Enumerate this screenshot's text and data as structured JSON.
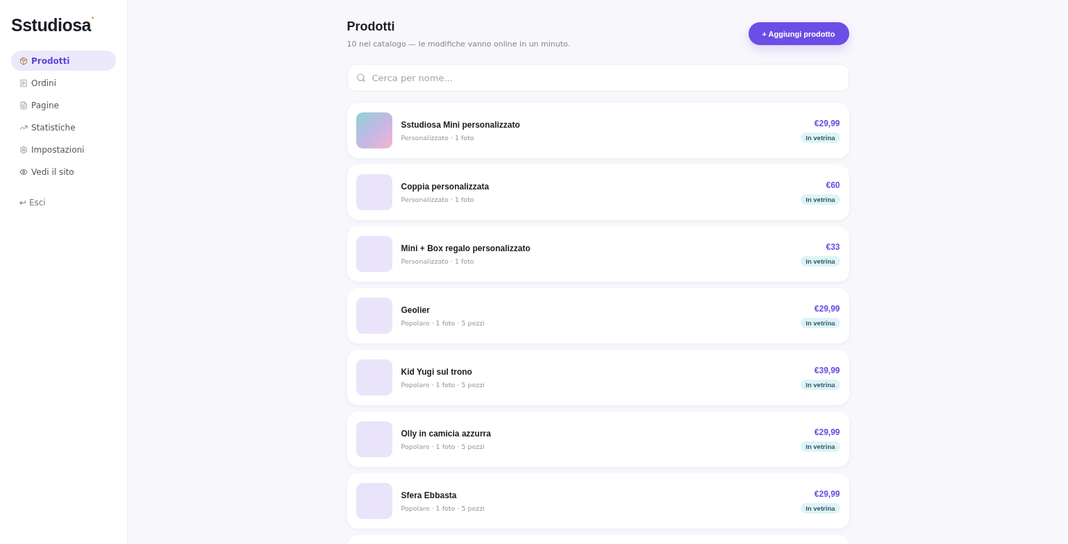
{
  "sidebar": {
    "logo": "Sstudiosa",
    "items": [
      {
        "label": "Prodotti",
        "selected": true
      },
      {
        "label": "Ordini",
        "selected": false
      },
      {
        "label": "Pagine",
        "selected": false
      },
      {
        "label": "Statistiche",
        "selected": false
      },
      {
        "label": "Impostazioni",
        "selected": false
      },
      {
        "label": "Vedi il sito",
        "selected": false
      }
    ],
    "logout": {
      "icon": "↩",
      "label": "Esci"
    }
  },
  "header": {
    "title": "Prodotti",
    "subtitle": "10 nel catalogo — le modifiche vanno online in un minuto.",
    "add_button": "+ Aggiungi prodotto"
  },
  "search": {
    "placeholder": "Cerca per nome..."
  },
  "products": [
    {
      "name": "Sstudiosa Mini personalizzato",
      "meta": "Personalizzato · 1 foto",
      "price": "€29,99",
      "status": "In vetrina",
      "kind": "photo"
    },
    {
      "name": "Coppia personalizzata",
      "meta": "Personalizzato · 1 foto",
      "price": "€60",
      "status": "In vetrina",
      "kind": "blank"
    },
    {
      "name": "Mini + Box regalo personalizzato",
      "meta": "Personalizzato · 1 foto",
      "price": "€33",
      "status": "In vetrina",
      "kind": "blank"
    },
    {
      "name": "Geolier",
      "meta": "Popolare · 1 foto · 5 pezzi",
      "price": "€29,99",
      "status": "In vetrina",
      "kind": "blank"
    },
    {
      "name": "Kid Yugi sul trono",
      "meta": "Popolare · 1 foto · 5 pezzi",
      "price": "€39,99",
      "status": "In vetrina",
      "kind": "blank"
    },
    {
      "name": "Olly in camicia azzurra",
      "meta": "Popolare · 1 foto · 5 pezzi",
      "price": "€29,99",
      "status": "In vetrina",
      "kind": "blank"
    },
    {
      "name": "Sfera Ebbasta",
      "meta": "Popolare · 1 foto · 5 pezzi",
      "price": "€29,99",
      "status": "In vetrina",
      "kind": "blank"
    }
  ]
}
